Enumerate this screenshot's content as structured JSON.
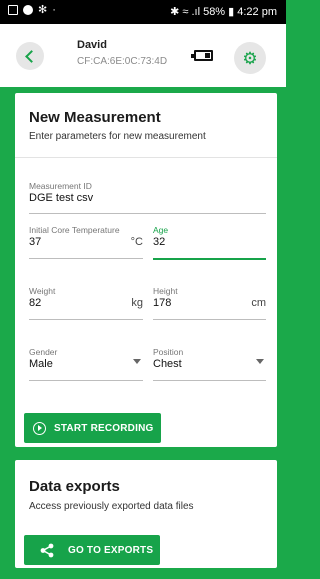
{
  "status_bar": {
    "right_text": "✱ ≈ .ıl 58% ▮ 4:22 pm"
  },
  "app_bar": {
    "device_name": "David",
    "device_mac": "CF:CA:6E:0C:73:4D",
    "icons": [
      "back-arrow-icon",
      "battery-icon",
      "settings-gear-icon"
    ]
  },
  "new_measurement": {
    "title": "New Measurement",
    "subtitle": "Enter parameters for new measurement",
    "measurement_id": {
      "label": "Measurement ID",
      "value": "DGE test csv"
    },
    "core_temperature": {
      "label": "Initial Core Temperature",
      "value": "37",
      "unit": "°C"
    },
    "age": {
      "label": "Age",
      "value": "32"
    },
    "weight": {
      "label": "Weight",
      "value": "82",
      "unit": "kg"
    },
    "height": {
      "label": "Height",
      "value": "178",
      "unit": "cm"
    },
    "gender": {
      "label": "Gender",
      "value": "Male"
    },
    "position": {
      "label": "Position",
      "value": "Chest"
    },
    "start_button": "START RECORDING"
  },
  "data_exports": {
    "title": "Data exports",
    "subtitle": "Access previously exported data files",
    "button": "GO TO EXPORTS"
  },
  "colors": {
    "accent": "#17a34a",
    "background": "#1ba94a"
  }
}
